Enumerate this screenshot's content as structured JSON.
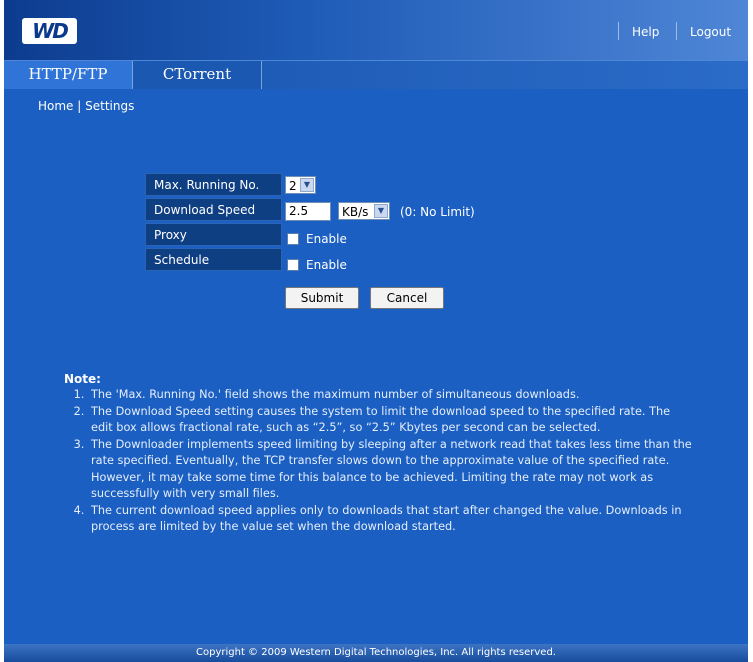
{
  "header": {
    "logo_text": "WD",
    "help": "Help",
    "logout": "Logout"
  },
  "tabs": [
    {
      "label": "HTTP/FTP",
      "active": true
    },
    {
      "label": "CTorrent",
      "active": false
    }
  ],
  "breadcrumb": {
    "home": "Home",
    "sep": "|",
    "current": "Settings"
  },
  "form": {
    "max_running_label": "Max. Running No.",
    "max_running_value": "2",
    "download_speed_label": "Download Speed",
    "download_speed_value": "2.5",
    "speed_unit": "KB/s",
    "speed_hint": "(0: No Limit)",
    "proxy_label": "Proxy",
    "proxy_enable": "Enable",
    "schedule_label": "Schedule",
    "schedule_enable": "Enable",
    "submit": "Submit",
    "cancel": "Cancel"
  },
  "note": {
    "title": "Note:",
    "items": [
      "The 'Max. Running No.' field shows the maximum number of simultaneous downloads.",
      "The Download Speed setting causes the system to limit the download speed to the specified rate. The edit box allows fractional rate, such as “2.5”, so “2.5” Kbytes per second can be selected.",
      "The Downloader implements speed limiting by sleeping after a network read that takes less time than the rate specified. Eventually, the TCP transfer slows down to the approximate value of the specified rate. However, it may take some time for this balance to be achieved. Limiting the rate may not work as successfully with very small files.",
      "The current download speed applies only to downloads that start after changed the value. Downloads in process are limited by the value set when the download started."
    ]
  },
  "footer": "Copyright © 2009 Western Digital Technologies, Inc. All rights reserved.",
  "colors": {
    "background": "#1a5fc1",
    "label_bg": "#0f3f83",
    "active_tab": "#2f74d6"
  }
}
